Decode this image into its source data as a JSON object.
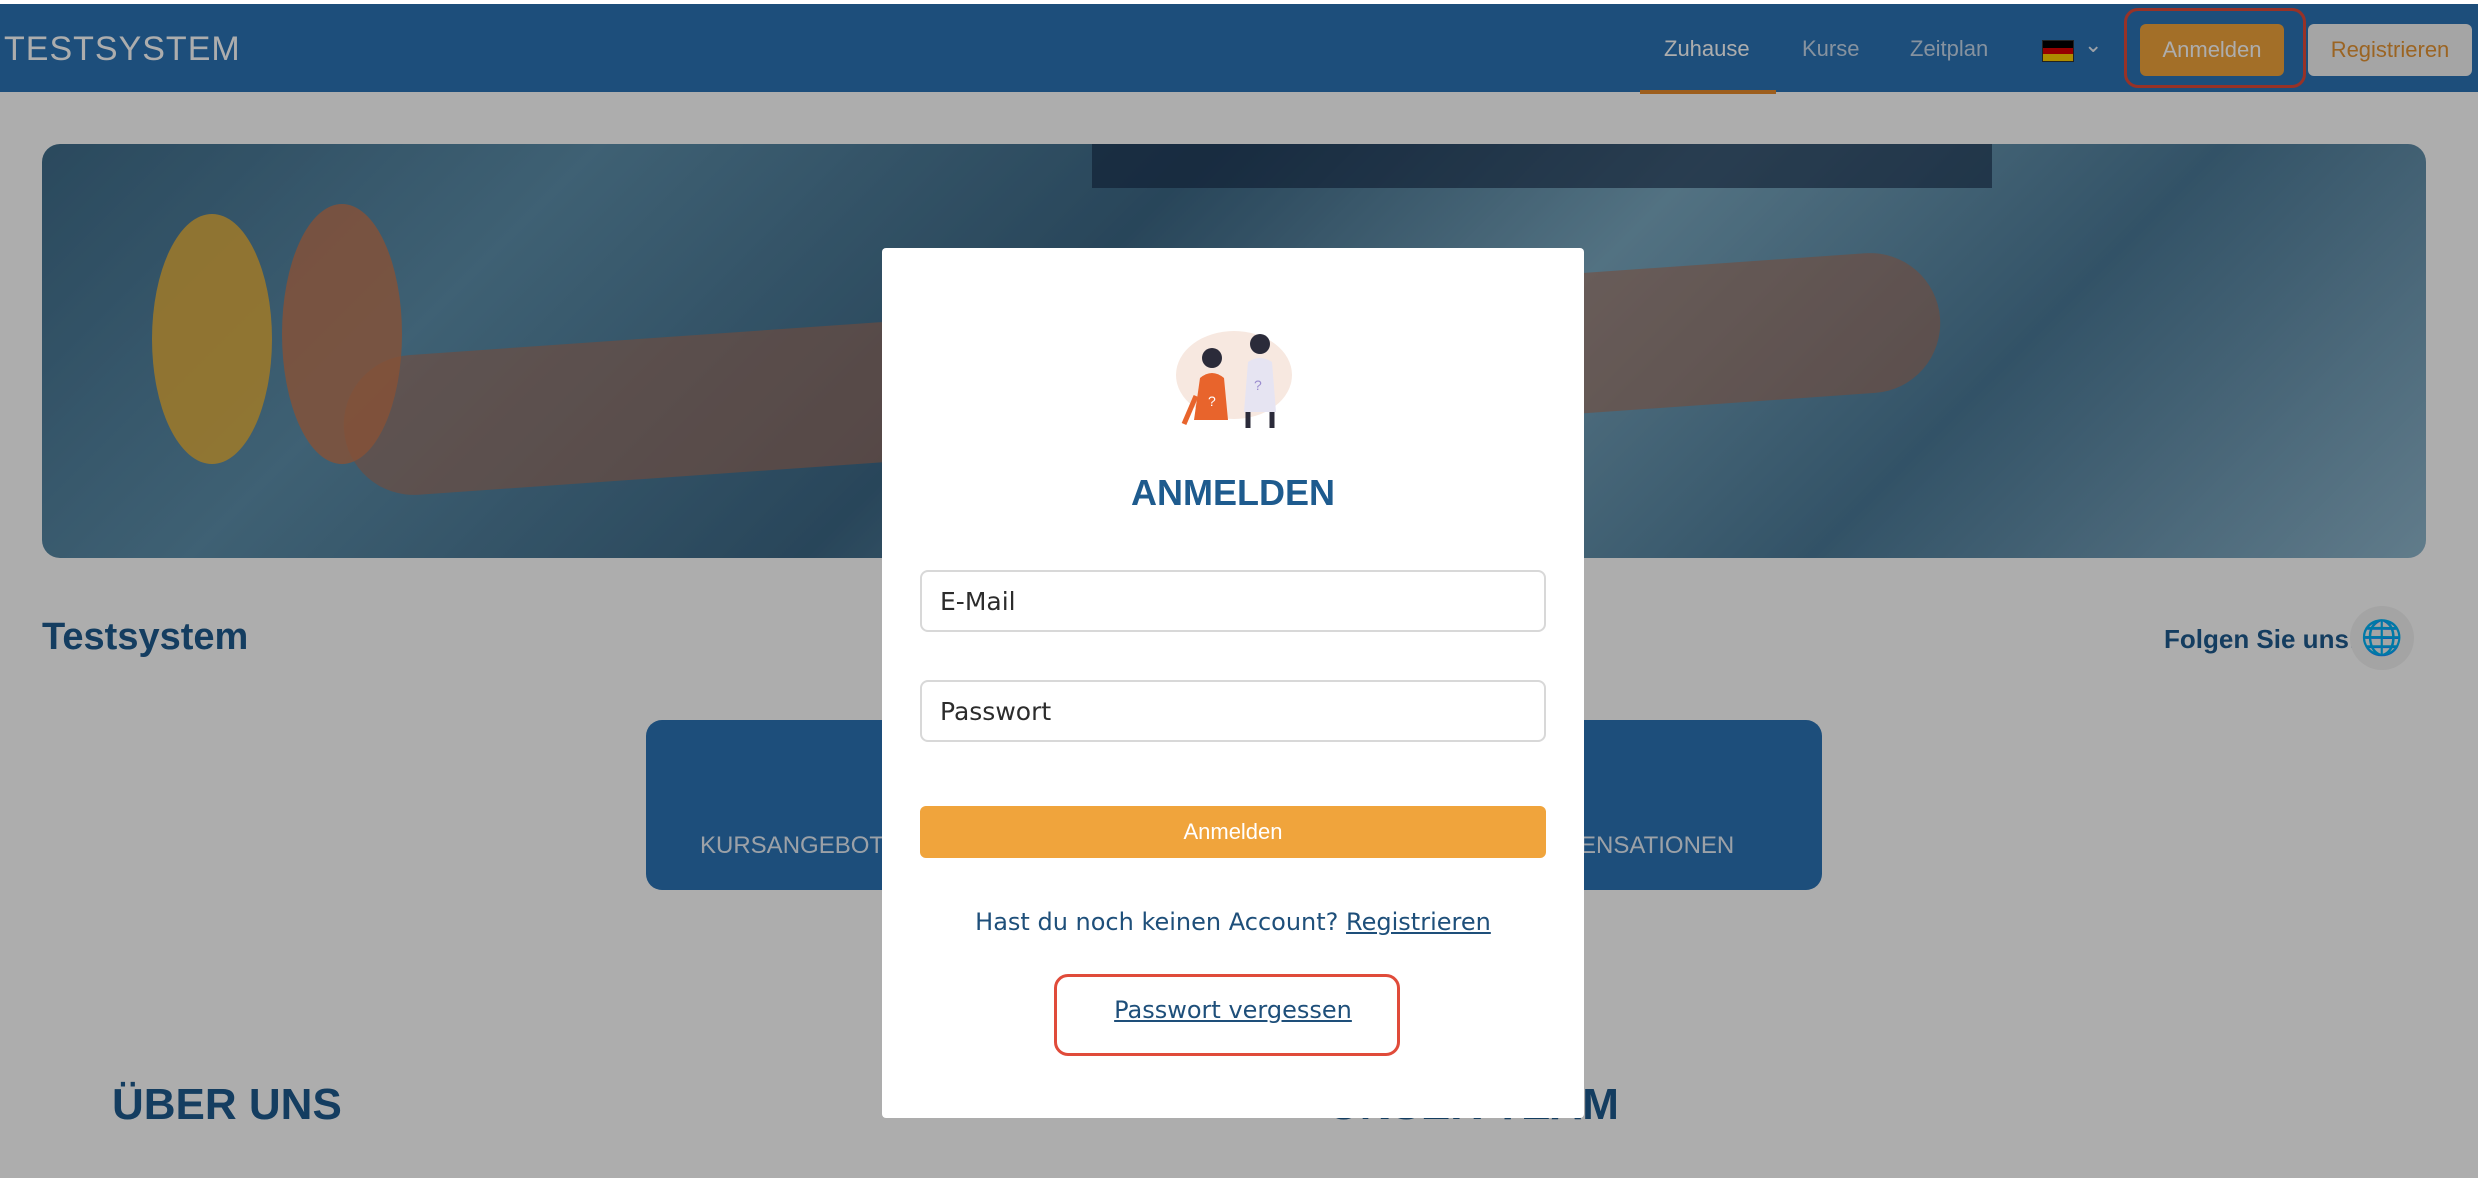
{
  "navbar": {
    "brand": "TESTSYSTEM",
    "links": [
      "Zuhause",
      "Kurse",
      "Zeitplan"
    ],
    "language_icon": "german-flag-icon",
    "login_label": "Anmelden",
    "register_label": "Registrieren"
  },
  "page": {
    "title": "Testsystem",
    "follow_label": "Folgen Sie uns:",
    "card_left_label": "KURSANGEBOT",
    "card_right_label": "ENSATIONEN",
    "panel_left_title": "ÜBER UNS",
    "panel_right_title": "UNSER TEAM"
  },
  "modal": {
    "title": "ANMELDEN",
    "email_placeholder": "E-Mail",
    "password_placeholder": "Passwort",
    "submit_label": "Anmelden",
    "no_account_text": "Hast du noch keinen Account?",
    "register_link": "Registrieren",
    "forgot_link": "Passwort vergessen"
  },
  "colors": {
    "navbar": "#2b74b6",
    "accent": "#f0a43c",
    "primary_text": "#1e5b8e",
    "highlight": "#e04b3a"
  }
}
